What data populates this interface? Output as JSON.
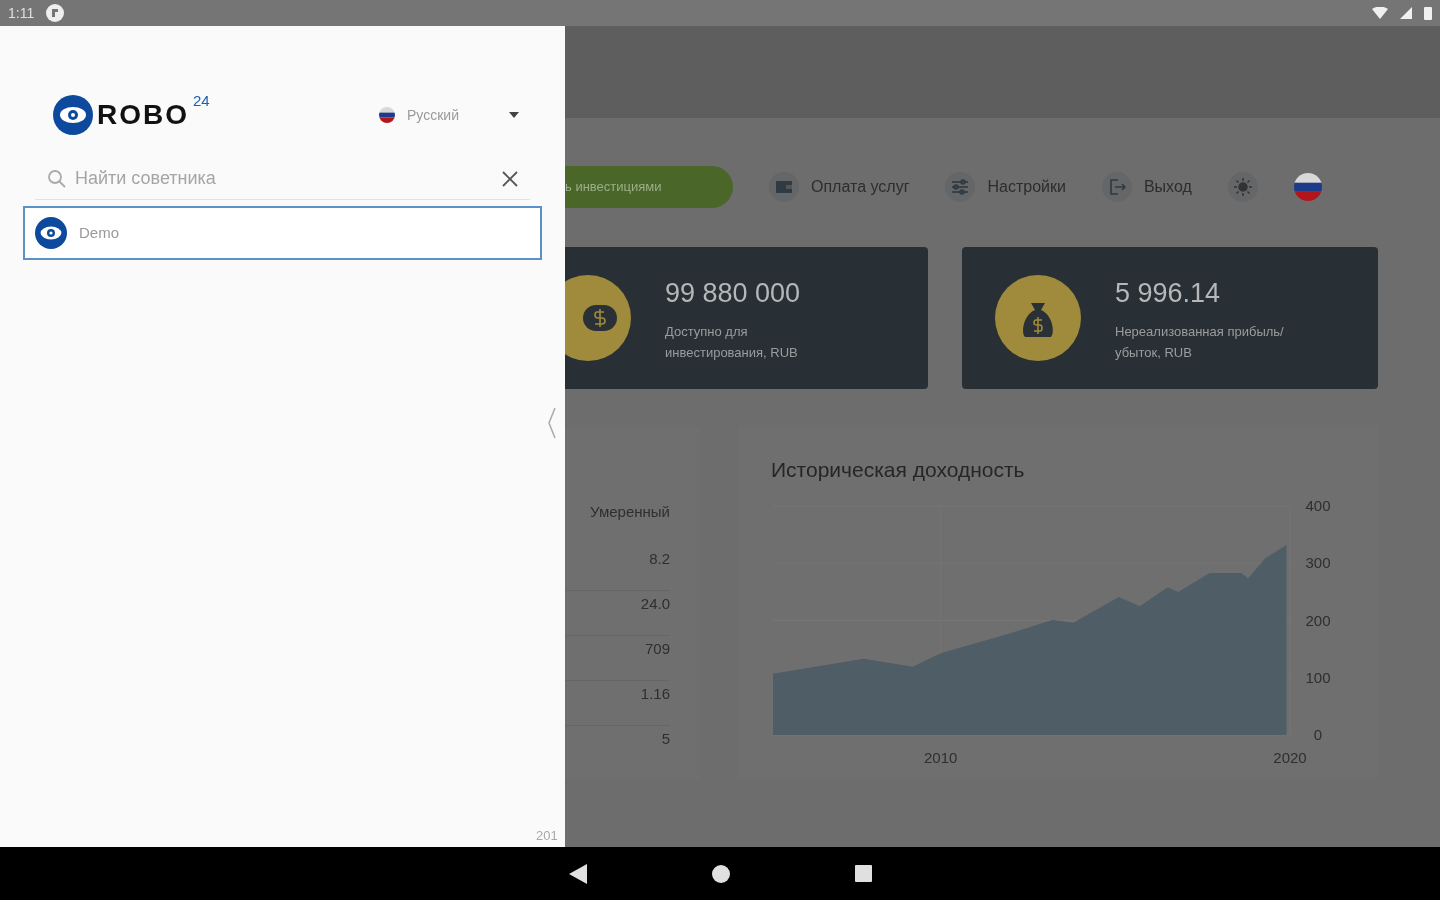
{
  "status_bar": {
    "time": "1:11"
  },
  "drawer": {
    "logo": {
      "text": "ROBO",
      "sup": "24"
    },
    "language": {
      "label": "Русский"
    },
    "search": {
      "placeholder": "Найти советника"
    },
    "advisors": [
      {
        "name": "Demo",
        "selected": true
      }
    ],
    "footer_text": "201"
  },
  "page": {
    "primary_button": "ь инвестициями",
    "nav_items": [
      {
        "kind": "wallet",
        "label": "Оплата услуг"
      },
      {
        "kind": "settings",
        "label": "Настройки"
      },
      {
        "kind": "logout",
        "label": "Выход"
      }
    ],
    "stats": [
      {
        "kind": "cash",
        "value": "99 880 000",
        "caption": "Доступно для инвестирования, RUB"
      },
      {
        "kind": "bag",
        "value": "5 996.14",
        "caption": "Нереализованная прибыль/ убыток, RUB"
      }
    ],
    "risk_table": {
      "header": "Умеренный",
      "values": [
        "8.2",
        "24.0",
        "709",
        "1.16",
        "5"
      ]
    },
    "chart": {
      "title": "Историческая доходность",
      "chart_data": {
        "type": "area",
        "x": [
          2005.2,
          2007.8,
          2009.2,
          2010,
          2011.9,
          2013.2,
          2013.8,
          2015.1,
          2015.7,
          2016.5,
          2016.8,
          2017.7,
          2018.6,
          2018.8,
          2019.3,
          2019.9
        ],
        "series": [
          {
            "color": "#4f5d66",
            "values": [
              107,
              133,
              119,
              143,
              176,
              201,
              196,
              241,
              225,
              258,
              250,
              283,
              283,
              274,
              309,
              332
            ]
          }
        ],
        "xlim": [
          2005.2,
          2020
        ],
        "ylim": [
          0,
          400
        ],
        "xticks": [
          2010,
          2020
        ],
        "yticks": [
          0,
          100,
          200,
          300,
          400
        ]
      }
    }
  }
}
